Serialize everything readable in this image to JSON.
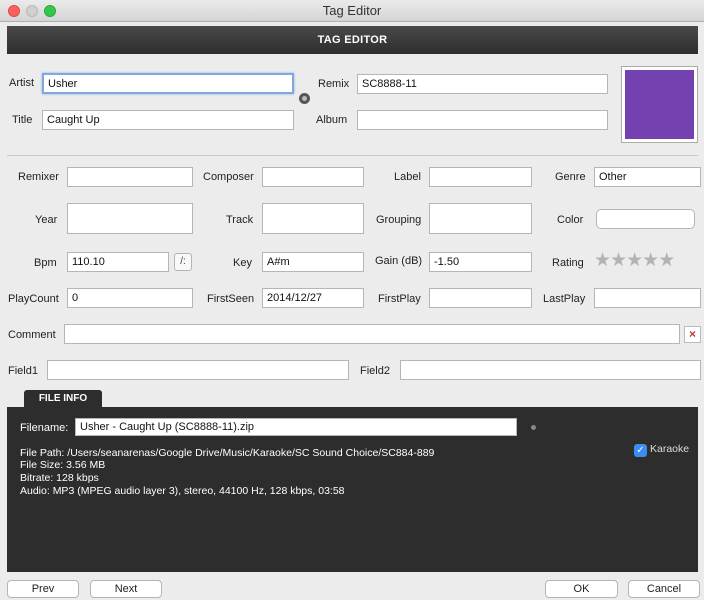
{
  "window": {
    "title": "Tag Editor"
  },
  "header": {
    "title": "TAG EDITOR"
  },
  "top": {
    "artist_label": "Artist",
    "artist_value": "Usher",
    "title_label": "Title",
    "title_value": "Caught Up",
    "remix_label": "Remix",
    "remix_value": "SC8888-11",
    "album_label": "Album",
    "album_value": "",
    "artwork_color": "#7442b0"
  },
  "fields": {
    "remixer_label": "Remixer",
    "remixer_value": "",
    "composer_label": "Composer",
    "composer_value": "",
    "label_label": "Label",
    "label_value": "",
    "genre_label": "Genre",
    "genre_value": "Other",
    "year_label": "Year",
    "year_value": "",
    "track_label": "Track",
    "track_value": "",
    "grouping_label": "Grouping",
    "grouping_value": "",
    "color_label": "Color",
    "bpm_label": "Bpm",
    "bpm_value": "110.10",
    "bpm_button": "/:",
    "key_label": "Key",
    "key_value": "A#m",
    "gain_label": "Gain (dB)",
    "gain_value": "-1.50",
    "rating_label": "Rating",
    "rating_value": 0,
    "rating_max": 5,
    "playcount_label": "PlayCount",
    "playcount_value": "0",
    "firstseen_label": "FirstSeen",
    "firstseen_value": "2014/12/27",
    "firstplay_label": "FirstPlay",
    "firstplay_value": "",
    "lastplay_label": "LastPlay",
    "lastplay_value": "",
    "comment_label": "Comment",
    "comment_value": "",
    "clear_icon": "×",
    "field1_label": "Field1",
    "field1_value": "",
    "field2_label": "Field2",
    "field2_value": ""
  },
  "fileinfo": {
    "tab_label": "FILE INFO",
    "filename_label": "Filename:",
    "filename_value": "Usher - Caught Up (SC8888-11).zip",
    "filepath": "File Path: /Users/seanarenas/Google Drive/Music/Karaoke/SC Sound Choice/SC884-889",
    "filesize": "File Size: 3.56 MB",
    "bitrate": "Bitrate: 128 kbps",
    "audio": "Audio: MP3 (MPEG audio layer 3), stereo, 44100 Hz, 128 kbps, 03:58",
    "karaoke_label": "Karaoke",
    "karaoke_checked": true,
    "check_icon": "✓"
  },
  "buttons": {
    "prev": "Prev",
    "next": "Next",
    "ok": "OK",
    "cancel": "Cancel"
  }
}
